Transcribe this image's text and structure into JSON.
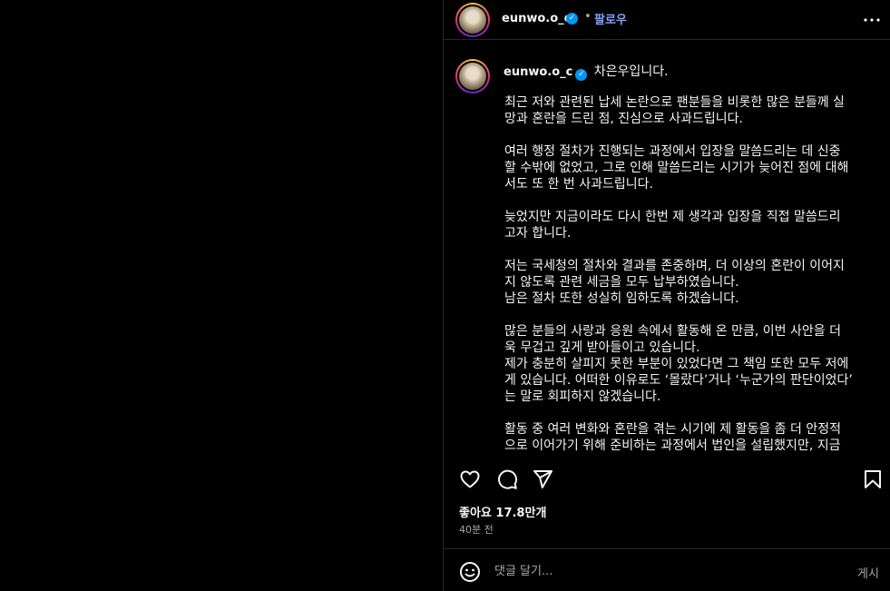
{
  "post": {
    "author": {
      "username": "eunwo.o_c",
      "verified": true,
      "follow_label": "팔로우",
      "separator": "•"
    },
    "caption": {
      "greeting": "차은우입니다.",
      "paragraphs": [
        "최근 저와 관련된 납세 논란으로 팬분들을 비롯한 많은 분들께 실\n망과 혼란을 드린 점, 진심으로 사과드립니다.",
        "여러 행정 절차가 진행되는 과정에서 입장을 말씀드리는 데 신중\n할 수밖에 없었고, 그로 인해 말씀드리는 시기가 늦어진 점에 대해\n서도 또 한 번 사과드립니다.",
        "늦었지만 지금이라도 다시 한번 제 생각과 입장을 직접 말씀드리\n고자 합니다.",
        "저는 국세청의 절차와 결과를 존중하며, 더 이상의 혼란이 이어지\n지 않도록 관련 세금을 모두 납부하였습니다.\n남은 절차 또한 성실히 임하도록 하겠습니다.",
        "많은 분들의 사랑과 응원 속에서 활동해 온 만큼, 이번 사안을 더\n욱 무겁고 깊게 받아들이고 있습니다.\n제가 충분히 살피지 못한 부분이 있었다면 그 책임 또한 모두 저에\n게 있습니다. 어떠한 이유로도 ‘몰랐다’거나 ‘누군가의 판단이었다’\n는 말로 회피하지 않겠습니다.",
        "활동 중 여러 변화와 혼란을 겪는 시기에 제 활동을 좀 더 안정적\n으로 이어가기 위해 준비하는 과정에서 법인을 설립했지만, 지금"
      ]
    },
    "likes_label": "좋아요 17.8만개",
    "time_ago": "40분 전"
  },
  "comment_bar": {
    "placeholder": "댓글 달기...",
    "post_label": "게시"
  },
  "icons": {
    "more": "more-horizontal-icon",
    "like": "heart-icon",
    "comment": "comment-icon",
    "share": "share-icon",
    "save": "bookmark-icon",
    "emoji": "emoji-icon",
    "verified": "verified-badge-icon"
  },
  "colors": {
    "background": "#000000",
    "text": "#f5f5f5",
    "secondary_text": "#a8a8a8",
    "follow": "#85a1ff",
    "verified": "#0095f6",
    "divider": "#262626"
  }
}
